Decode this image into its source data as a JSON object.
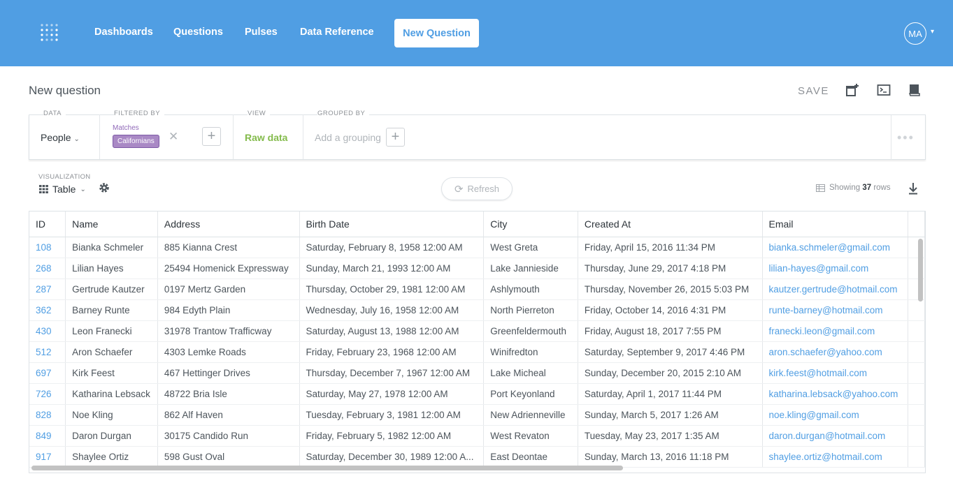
{
  "nav": {
    "links": [
      "Dashboards",
      "Questions",
      "Pulses",
      "Data Reference"
    ],
    "new_question": "New Question",
    "avatar_initials": "MA",
    "color": "#509ee3"
  },
  "header": {
    "title": "New question",
    "save": "SAVE",
    "icons": [
      "add-to-dashboard-icon",
      "sql-editor-icon",
      "reference-book-icon"
    ]
  },
  "query_builder": {
    "data_label": "DATA",
    "data_value": "People",
    "filtered_label": "FILTERED BY",
    "filter_matches": "Matches",
    "filter_segment": "Californians",
    "view_label": "VIEW",
    "view_value": "Raw data",
    "grouped_label": "GROUPED BY",
    "grouped_placeholder": "Add a grouping",
    "more": "•••"
  },
  "viz": {
    "label": "VISUALIZATION",
    "type": "Table",
    "refresh": "Refresh",
    "showing_prefix": "Showing",
    "row_count": "37",
    "showing_suffix": "rows"
  },
  "table": {
    "columns": [
      "ID",
      "Name",
      "Address",
      "Birth Date",
      "City",
      "Created At",
      "Email"
    ],
    "rows": [
      [
        "108",
        "Bianka Schmeler",
        "885 Kianna Crest",
        "Saturday, February 8, 1958 12:00 AM",
        "West Greta",
        "Friday, April 15, 2016 11:34 PM",
        "bianka.schmeler@gmail.com"
      ],
      [
        "268",
        "Lilian Hayes",
        "25494 Homenick Expressway",
        "Sunday, March 21, 1993 12:00 AM",
        "Lake Jannieside",
        "Thursday, June 29, 2017 4:18 PM",
        "lilian-hayes@gmail.com"
      ],
      [
        "287",
        "Gertrude Kautzer",
        "0197 Mertz Garden",
        "Thursday, October 29, 1981 12:00 AM",
        "Ashlymouth",
        "Thursday, November 26, 2015 5:03 PM",
        "kautzer.gertrude@hotmail.com"
      ],
      [
        "362",
        "Barney Runte",
        "984 Edyth Plain",
        "Wednesday, July 16, 1958 12:00 AM",
        "North Pierreton",
        "Friday, October 14, 2016 4:31 PM",
        "runte-barney@hotmail.com"
      ],
      [
        "430",
        "Leon Franecki",
        "31978 Trantow Trafficway",
        "Saturday, August 13, 1988 12:00 AM",
        "Greenfeldermouth",
        "Friday, August 18, 2017 7:55 PM",
        "franecki.leon@gmail.com"
      ],
      [
        "512",
        "Aron Schaefer",
        "4303 Lemke Roads",
        "Friday, February 23, 1968 12:00 AM",
        "Winifredton",
        "Saturday, September 9, 2017 4:46 PM",
        "aron.schaefer@yahoo.com"
      ],
      [
        "697",
        "Kirk Feest",
        "467 Hettinger Drives",
        "Thursday, December 7, 1967 12:00 AM",
        "Lake Micheal",
        "Sunday, December 20, 2015 2:10 AM",
        "kirk.feest@hotmail.com"
      ],
      [
        "726",
        "Katharina Lebsack",
        "48722 Bria Isle",
        "Saturday, May 27, 1978 12:00 AM",
        "Port Keyonland",
        "Saturday, April 1, 2017 11:44 PM",
        "katharina.lebsack@yahoo.com"
      ],
      [
        "828",
        "Noe Kling",
        "862 Alf Haven",
        "Tuesday, February 3, 1981 12:00 AM",
        "New Adrienneville",
        "Sunday, March 5, 2017 1:26 AM",
        "noe.kling@gmail.com"
      ],
      [
        "849",
        "Daron Durgan",
        "30175 Candido Run",
        "Friday, February 5, 1982 12:00 AM",
        "West Revaton",
        "Tuesday, May 23, 2017 1:35 AM",
        "daron.durgan@hotmail.com"
      ],
      [
        "917",
        "Shaylee Ortiz",
        "598 Gust Oval",
        "Saturday, December 30, 1989 12:00 A...",
        "East Deontae",
        "Sunday, March 13, 2016 11:18 PM",
        "shaylee.ortiz@hotmail.com"
      ]
    ]
  }
}
